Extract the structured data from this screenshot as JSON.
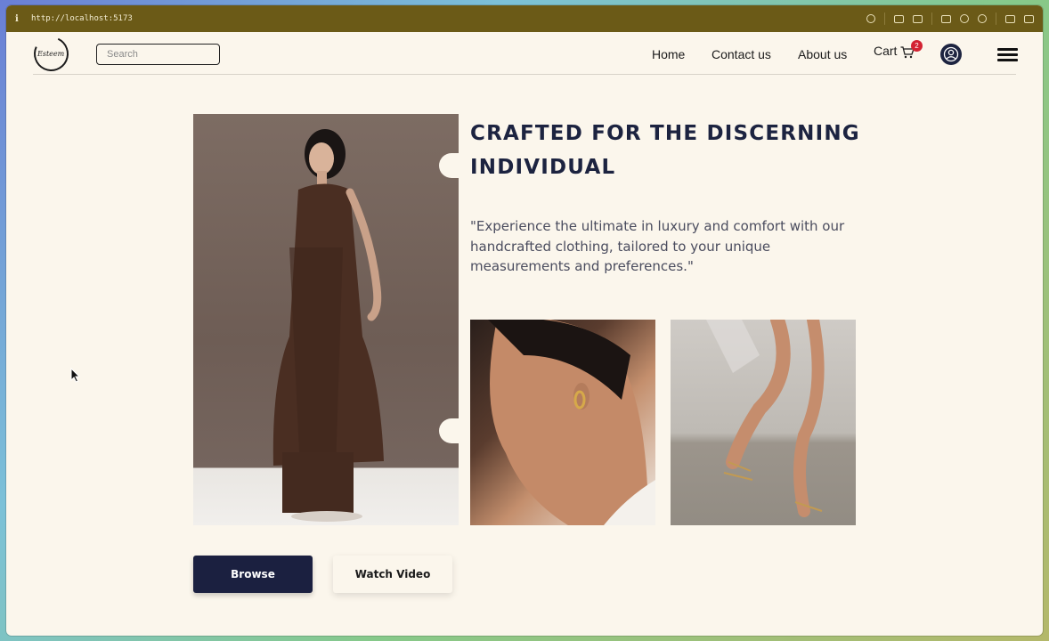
{
  "browser": {
    "url": "http://localhost:5173",
    "info_icon": "i"
  },
  "nav": {
    "logo_text": "Esteem",
    "search_placeholder": "Search",
    "links": [
      "Home",
      "Contact us",
      "About us"
    ],
    "cart_label": "Cart",
    "cart_count": "2"
  },
  "hero": {
    "heading_line1": "CRAFTED FOR THE DISCERNING",
    "heading_line2": "INDIVIDUAL",
    "quote": "\"Experience the ultimate in luxury and comfort with our handcrafted clothing, tailored to your unique measurements and preferences.\"",
    "browse_label": "Browse",
    "watch_label": "Watch Video"
  },
  "colors": {
    "page_bg": "#fbf6ec",
    "accent_navy": "#1b2040",
    "url_bar": "#6b5a17",
    "badge_red": "#d32333"
  }
}
